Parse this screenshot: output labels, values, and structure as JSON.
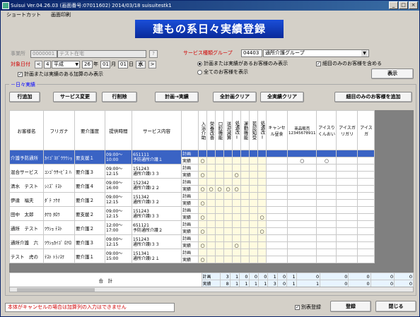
{
  "window": {
    "title": "Suisui Ver.04.26.03 (画面番号:07011602) 2014/03/18 suisuitestk1"
  },
  "menu": [
    "ショートカット",
    "画面印刷"
  ],
  "banner": "建もの系日々実績登録",
  "office": {
    "label": "事業所",
    "code": "0000001",
    "name": "テスト在宅",
    "btn": "?"
  },
  "service_group": {
    "label": "サービス種類グループ",
    "code": "04403",
    "name": "通所介護グループ"
  },
  "date": {
    "label": "対象日付",
    "era_num": "4",
    "era": "平成",
    "year": "26",
    "year_unit": "年",
    "month": "01",
    "month_unit": "月",
    "day": "01",
    "day_unit": "日",
    "weekday": "水",
    "prev": "<",
    "next": ">"
  },
  "options": {
    "radio1": "計画または実績があるお客様のみ表示",
    "radio2": "全てのお客様を表示",
    "chk_detail": "細目のみのお客様を含める",
    "chk_addon": "計画または実績のある加算のみ表示",
    "show_btn": "表示"
  },
  "section_label": "日々実績",
  "toolbar": {
    "add_row": "行追加",
    "change_service": "サービス変更",
    "delete_row": "行削除",
    "plan_to_actual": "計画→実績",
    "clear_plan": "全計画クリア",
    "clear_actual": "全実績クリア",
    "add_detail": "細目のみのお客様を追加"
  },
  "columns": {
    "name": "お客様名",
    "kana": "フリガナ",
    "care": "要介護度",
    "time": "提供時間",
    "service": "サービス内容",
    "addons": [
      "入浴介助",
      "栄養改善",
      "口腔機能",
      "送迎減算",
      "処遇改Ⅰ",
      "運動機能",
      "若認知受",
      "処遇改Ⅰ",
      "キャンセル昼食",
      "商品販売12345678911",
      "アイスりくんおい",
      "アイスガリガリ",
      "アイスガ"
    ]
  },
  "kubun": {
    "plan": "計画",
    "actual": "実績"
  },
  "mark": "○",
  "rows": [
    {
      "name": "介護予防通所",
      "kana": "ｶｲｺﾞﾖﾎﾞｳｳｳｼｮ",
      "care": "要支援１",
      "time": "09:00～\n10:00",
      "code": "651111",
      "service": "予防通所介護１",
      "plan": [],
      "actual": [
        0,
        9,
        10
      ]
    },
    {
      "name": "混合サービス",
      "kana": "ｺﾝｺﾞｳｻｰﾋﾞｽ ﾊ",
      "care": "要介護３",
      "time": "09:00～\n12:15",
      "code": "151243",
      "service": "通所介護Ⅰ３３",
      "plan": [],
      "actual": [
        0,
        4
      ]
    },
    {
      "name": "清水　テスト",
      "kana": "ｼﾐｽﾞ ﾃｽﾄ",
      "care": "要介護４",
      "time": "09:00～\n16:00",
      "code": "152342",
      "service": "通所介護Ⅰ２２",
      "plan": [],
      "actual": [
        0,
        1,
        2,
        3,
        4
      ]
    },
    {
      "name": "伊達　福夫",
      "kana": "ﾀﾞﾃ ﾌｸｵ",
      "care": "要介護２",
      "time": "09:00～\n12:15",
      "code": "151342",
      "service": "通所介護Ⅰ３２",
      "plan": [],
      "actual": [
        0
      ]
    },
    {
      "name": "田中　太郎",
      "kana": "ﾀﾅｶ ﾀﾛｳ",
      "care": "要支援２",
      "time": "09:00～\n12:15",
      "code": "151243",
      "service": "通所介護Ⅰ３３",
      "plan": [],
      "actual": [
        0,
        7
      ]
    },
    {
      "name": "通所　テスト",
      "kana": "ﾂｳｼｮ ﾃｽﾄ",
      "care": "要介護２",
      "time": "12:00～\n17:00",
      "code": "651121",
      "service": "予防通所介護２",
      "plan": [],
      "actual": [
        0,
        7
      ]
    },
    {
      "name": "通所介護　六",
      "kana": "ﾂｳｼｮｶｲｺﾞ ﾛｸﾛ",
      "care": "要介護３",
      "time": "09:00～\n12:15",
      "code": "151243",
      "service": "通所介護Ⅰ３３",
      "plan": [],
      "actual": [
        0,
        4
      ]
    },
    {
      "name": "テスト　虎の",
      "kana": "ﾃｽﾄ ﾄﾗﾉｽｹ",
      "care": "要介護１",
      "time": "09:00～\n15:00",
      "code": "151341",
      "service": "通所介護Ⅰ２１",
      "plan": [],
      "actual": [
        0
      ]
    }
  ],
  "total": {
    "label": "合　計",
    "plan": [
      "3",
      "1",
      "0",
      "0",
      "0",
      "1",
      "0",
      "1",
      "0",
      "0",
      "0",
      "0",
      "0"
    ],
    "actual": [
      "8",
      "1",
      "1",
      "1",
      "1",
      "3",
      "0",
      "1",
      "1",
      "0",
      "0",
      "0",
      "0"
    ]
  },
  "status_msg": "本体がキャンセルの場合は加算列の入力はできません",
  "footer": {
    "chk_separate": "別表登録",
    "register": "登録",
    "close": "閉じる"
  }
}
